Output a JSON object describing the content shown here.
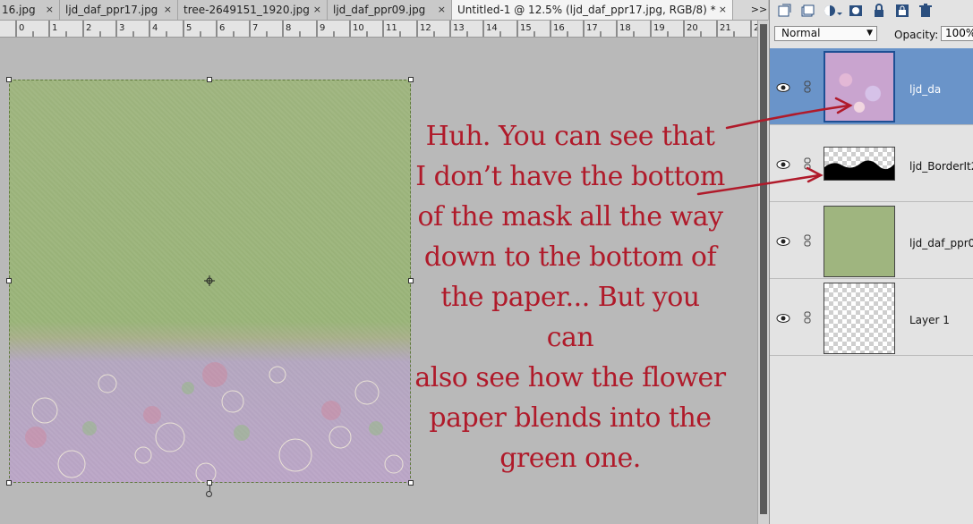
{
  "tabs": [
    {
      "label": "16.jpg",
      "close": "×",
      "active": false
    },
    {
      "label": "ljd_daf_ppr17.jpg",
      "close": "×",
      "active": false
    },
    {
      "label": "tree-2649151_1920.jpg",
      "close": "×",
      "active": false
    },
    {
      "label": "ljd_daf_ppr09.jpg",
      "close": "×",
      "active": false
    },
    {
      "label": "Untitled-1 @ 12.5% (ljd_daf_ppr17.jpg, RGB/8) *",
      "close": "×",
      "active": true
    }
  ],
  "tab_overflow": ">>",
  "ruler": {
    "numbers": [
      "0",
      "1",
      "2",
      "3",
      "4",
      "5",
      "6",
      "7",
      "8",
      "9",
      "10",
      "11",
      "12",
      "13",
      "14",
      "15",
      "16",
      "17",
      "18",
      "19",
      "20",
      "21",
      "2"
    ]
  },
  "annotation": {
    "lines": [
      "Huh. You can see that",
      "I don’t have the bottom",
      "of the mask all the way",
      "down to the bottom of",
      "the paper... But you can",
      "also see how the flower",
      "paper blends into the",
      "green one."
    ],
    "color": "#b01a2a"
  },
  "layers_panel": {
    "blend_mode": "Normal",
    "opacity_label": "Opacity:",
    "opacity_value": "100%",
    "layers": [
      {
        "name": "ljd_da",
        "selected": true,
        "thumb": "flower-paper"
      },
      {
        "name": "ljd_BorderIt2",
        "selected": false,
        "thumb": "mask"
      },
      {
        "name": "ljd_daf_ppr0",
        "selected": false,
        "thumb": "green-paper"
      },
      {
        "name": "Layer 1",
        "selected": false,
        "thumb": "transparent"
      }
    ]
  },
  "colors": {
    "selection_blue": "#6a94c9",
    "canvas_bg": "#b9b9b9",
    "green_paper": "#9fb57f",
    "flower_paper": "#bba6c7"
  }
}
